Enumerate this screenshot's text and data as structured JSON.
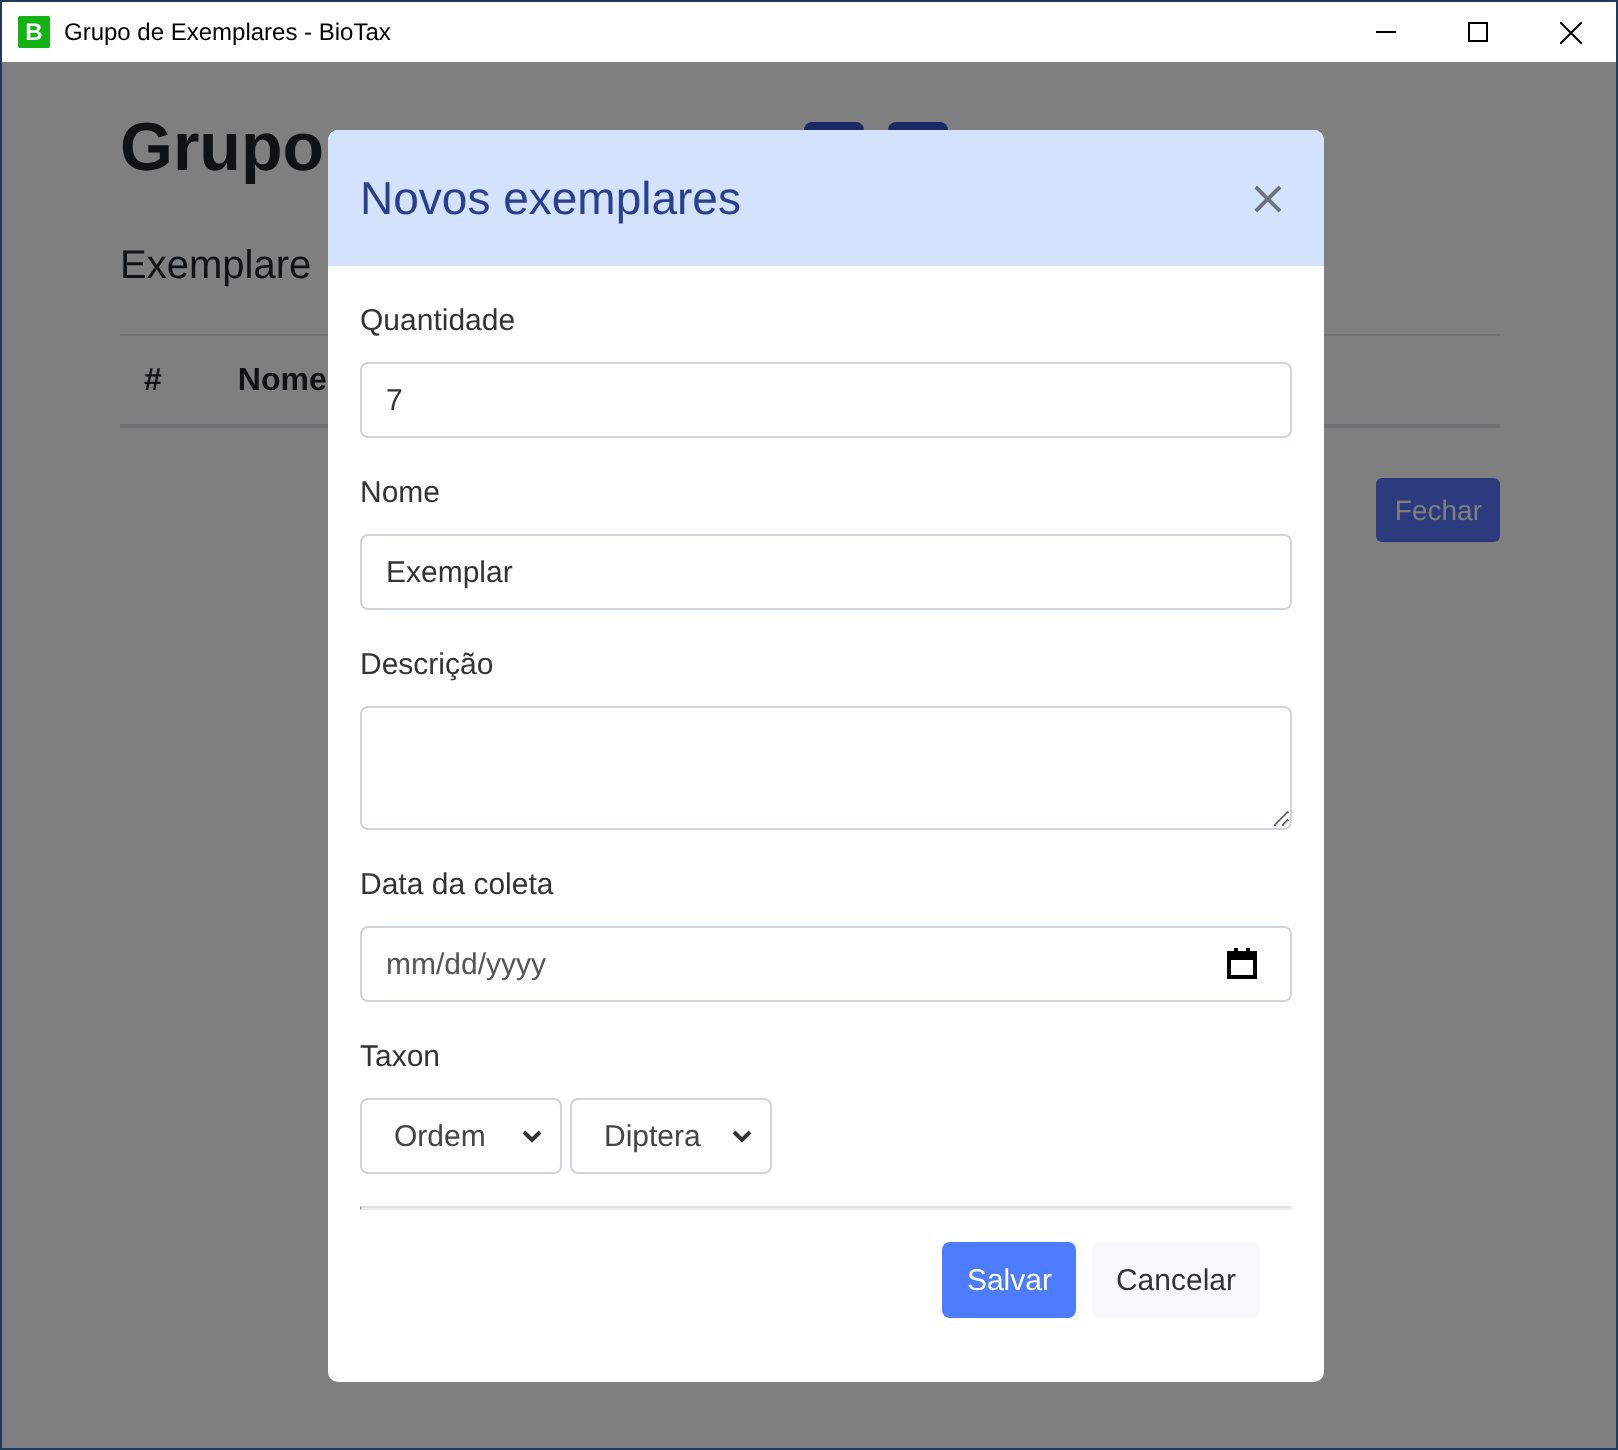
{
  "window": {
    "title": "Grupo de Exemplares - BioTax",
    "app_icon": "B"
  },
  "background_page": {
    "title": "Grupo",
    "subtitle": "Exemplare",
    "table_columns": [
      "#",
      "Nome"
    ],
    "close_button": "Fechar"
  },
  "dialog": {
    "title": "Novos exemplares",
    "close": "×",
    "fields": [
      {
        "kind": "text",
        "label": "Quantidade",
        "value": "7"
      },
      {
        "kind": "text",
        "label": "Nome",
        "value": "Exemplar"
      },
      {
        "kind": "textarea",
        "label": "Descrição"
      },
      {
        "kind": "date",
        "label": "Data da coleta",
        "placeholder": "mm/dd/yyyy"
      },
      {
        "kind": "selects",
        "label": "Taxon",
        "options": [
          "Ordem",
          "Diptera"
        ]
      }
    ],
    "buttons": [
      {
        "label": "Salvar",
        "kind": "primary"
      },
      {
        "label": "Cancelar",
        "kind": "secondary"
      }
    ]
  }
}
